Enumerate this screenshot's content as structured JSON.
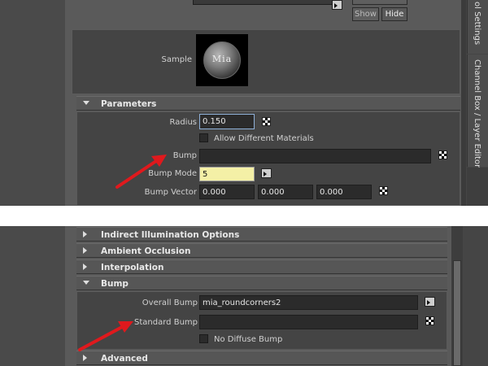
{
  "top": {
    "show_label": "Show",
    "hide_label": "Hide",
    "sample_label": "Sample",
    "sample_logo_text": "Mia"
  },
  "parameters": {
    "header": "Parameters",
    "radius_label": "Radius",
    "radius_value": "0.150",
    "allow_diff_label": "Allow Different Materials",
    "bump_label": "Bump",
    "bump_value": "",
    "bump_mode_label": "Bump Mode",
    "bump_mode_value": "5",
    "bump_vector_label": "Bump Vector",
    "bump_vector": [
      "0.000",
      "0.000",
      "0.000"
    ]
  },
  "sections": {
    "indirect": "Indirect Illumination Options",
    "ambient": "Ambient Occlusion",
    "interpolation": "Interpolation",
    "bump": "Bump",
    "advanced": "Advanced"
  },
  "bump_section": {
    "overall_label": "Overall Bump",
    "overall_value": "mia_roundcorners2",
    "standard_label": "Standard Bump",
    "standard_value": "",
    "no_diffuse_label": "No Diffuse Bump"
  },
  "side_tabs": {
    "settings_tab": "ol Settings",
    "channel_tab": "Channel Box / Layer Editor"
  },
  "colors": {
    "arrow": "#e0191d",
    "highlight_field": "#f4f0a6"
  }
}
